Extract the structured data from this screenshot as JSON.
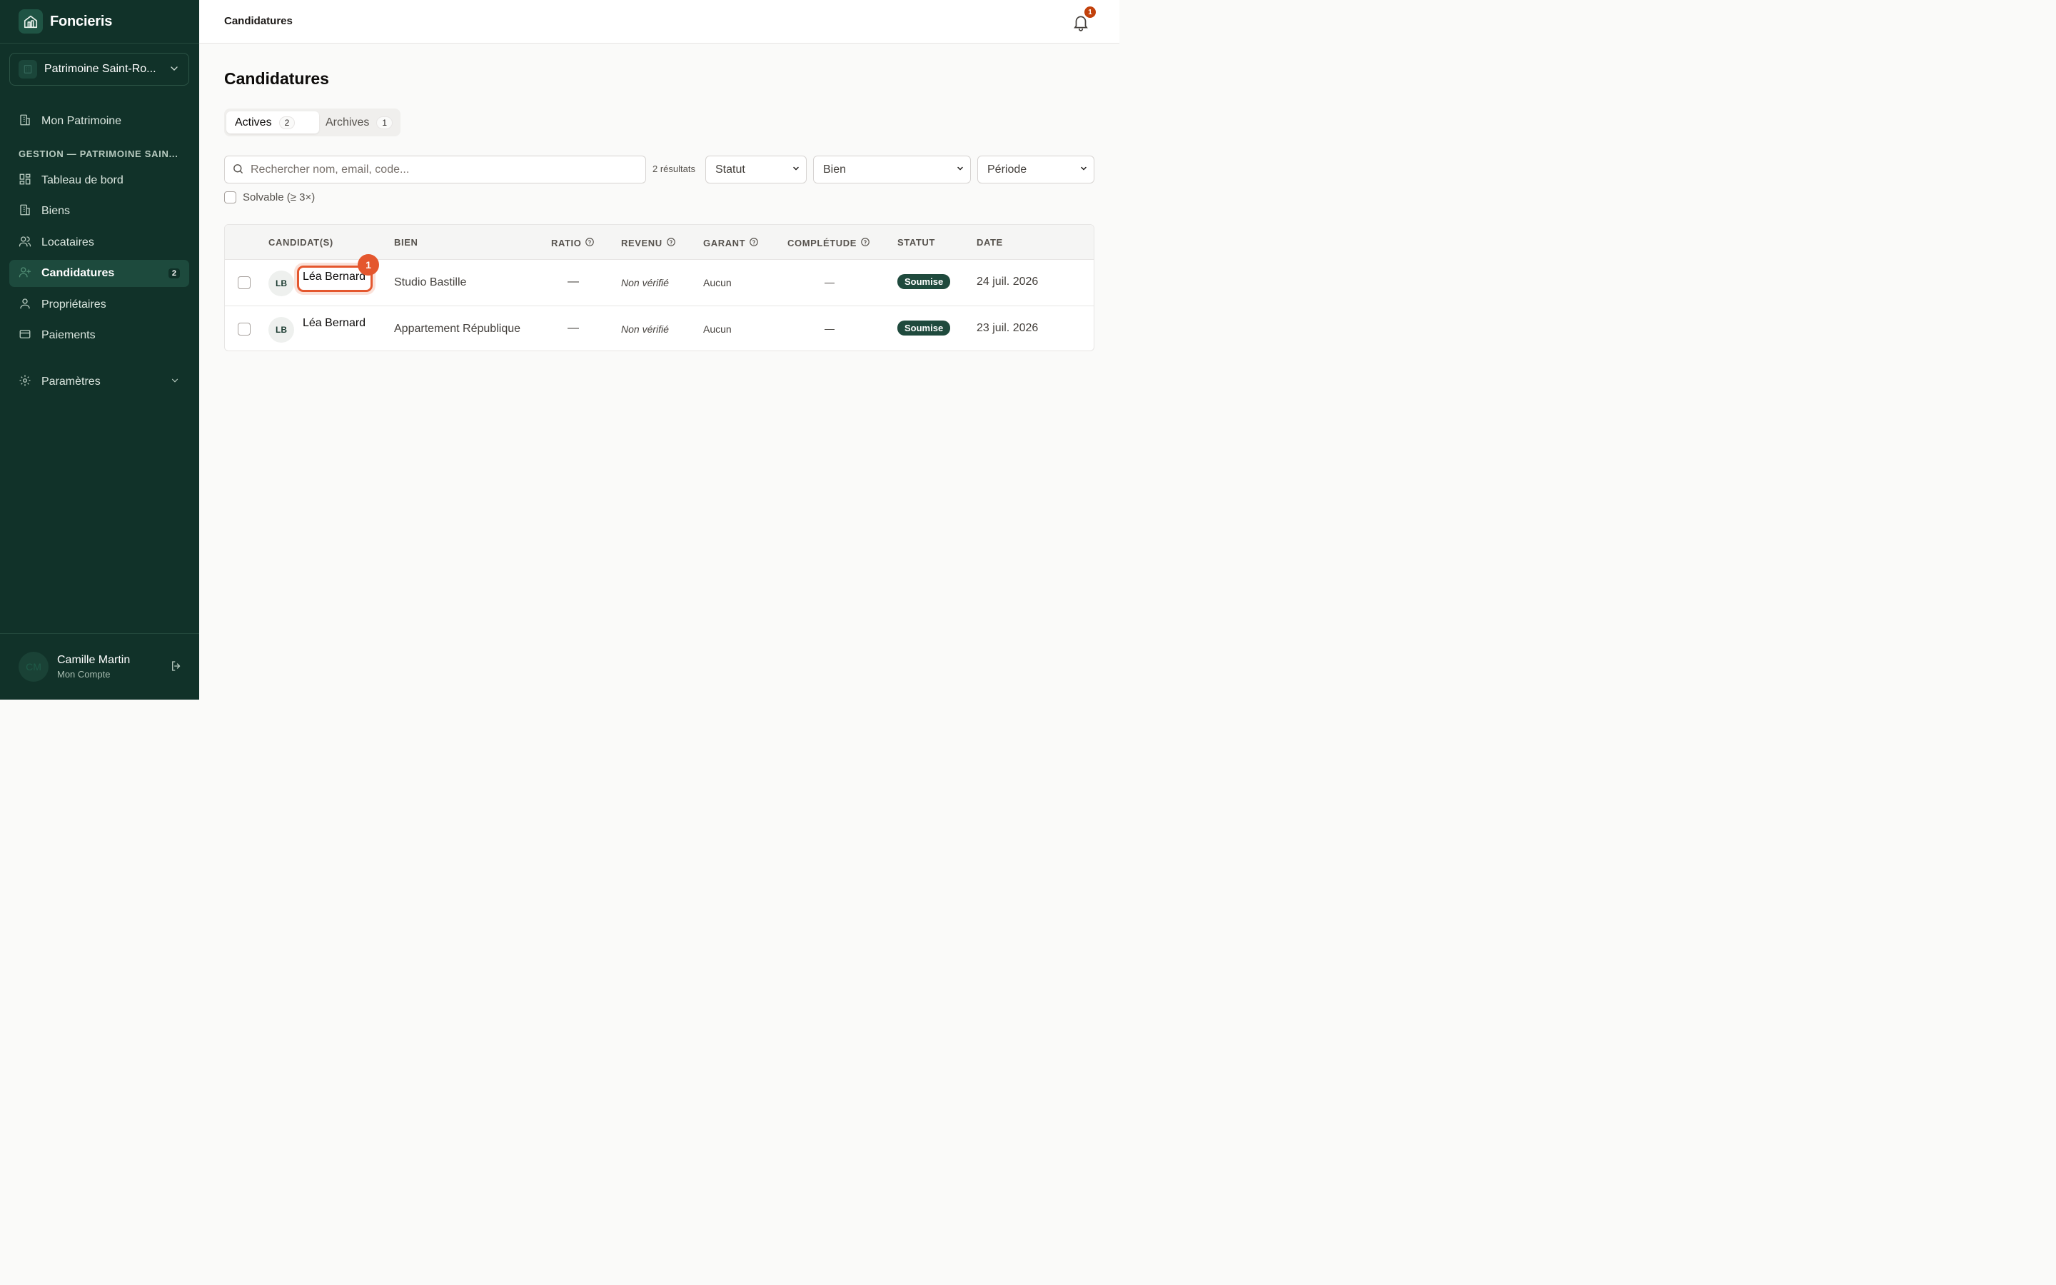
{
  "sidebar": {
    "brand": "Foncieris",
    "org_name": "Patrimoine Saint-Ro...",
    "nav_top": [
      {
        "label": "Mon Patrimoine",
        "icon": "building-icon"
      }
    ],
    "section_label": "GESTION — PATRIMOINE SAIN...",
    "nav_items": [
      {
        "label": "Tableau de bord",
        "icon": "dashboard-icon",
        "active": false
      },
      {
        "label": "Biens",
        "icon": "building-icon",
        "active": false
      },
      {
        "label": "Locataires",
        "icon": "users-icon",
        "active": false
      },
      {
        "label": "Candidatures",
        "icon": "user-plus-icon",
        "active": true,
        "badge": "2"
      },
      {
        "label": "Propriétaires",
        "icon": "user-icon",
        "active": false
      },
      {
        "label": "Paiements",
        "icon": "credit-card-icon",
        "active": false
      }
    ],
    "settings": {
      "label": "Paramètres",
      "icon": "gear-icon"
    },
    "user": {
      "initials": "CM",
      "name": "Camille Martin",
      "sub": "Mon Compte"
    }
  },
  "header": {
    "title": "Candidatures",
    "notification_count": "1"
  },
  "main": {
    "title": "Candidatures",
    "tabs": [
      {
        "label": "Actives",
        "count": "2",
        "active": true
      },
      {
        "label": "Archives",
        "count": "1",
        "active": false
      }
    ],
    "search_placeholder": "Rechercher nom, email, code...",
    "results_text": "2 résultats",
    "filters": {
      "statut": "Statut",
      "bien": "Bien",
      "periode": "Période"
    },
    "solvable_label": "Solvable (≥ 3×)",
    "columns": {
      "candidat": "CANDIDAT(S)",
      "bien": "BIEN",
      "ratio": "RATIO",
      "revenu": "REVENU",
      "garant": "GARANT",
      "completude": "COMPLÉTUDE",
      "statut": "STATUT",
      "date": "DATE"
    },
    "rows": [
      {
        "initials": "LB",
        "name": "Léa Bernard",
        "bien": "Studio Bastille",
        "ratio": "—",
        "revenu": "Non vérifié",
        "garant": "Aucun",
        "completude": "—",
        "statut": "Soumise",
        "date": "24 juil. 2026",
        "marker": "1"
      },
      {
        "initials": "LB",
        "name": "Léa Bernard",
        "bien": "Appartement République",
        "ratio": "—",
        "revenu": "Non vérifié",
        "garant": "Aucun",
        "completude": "—",
        "statut": "Soumise",
        "date": "23 juil. 2026"
      }
    ]
  },
  "colors": {
    "sidebar_bg": "#113229",
    "accent": "#1f4a3d",
    "marker": "#e4572e",
    "notification": "#c2410c"
  }
}
